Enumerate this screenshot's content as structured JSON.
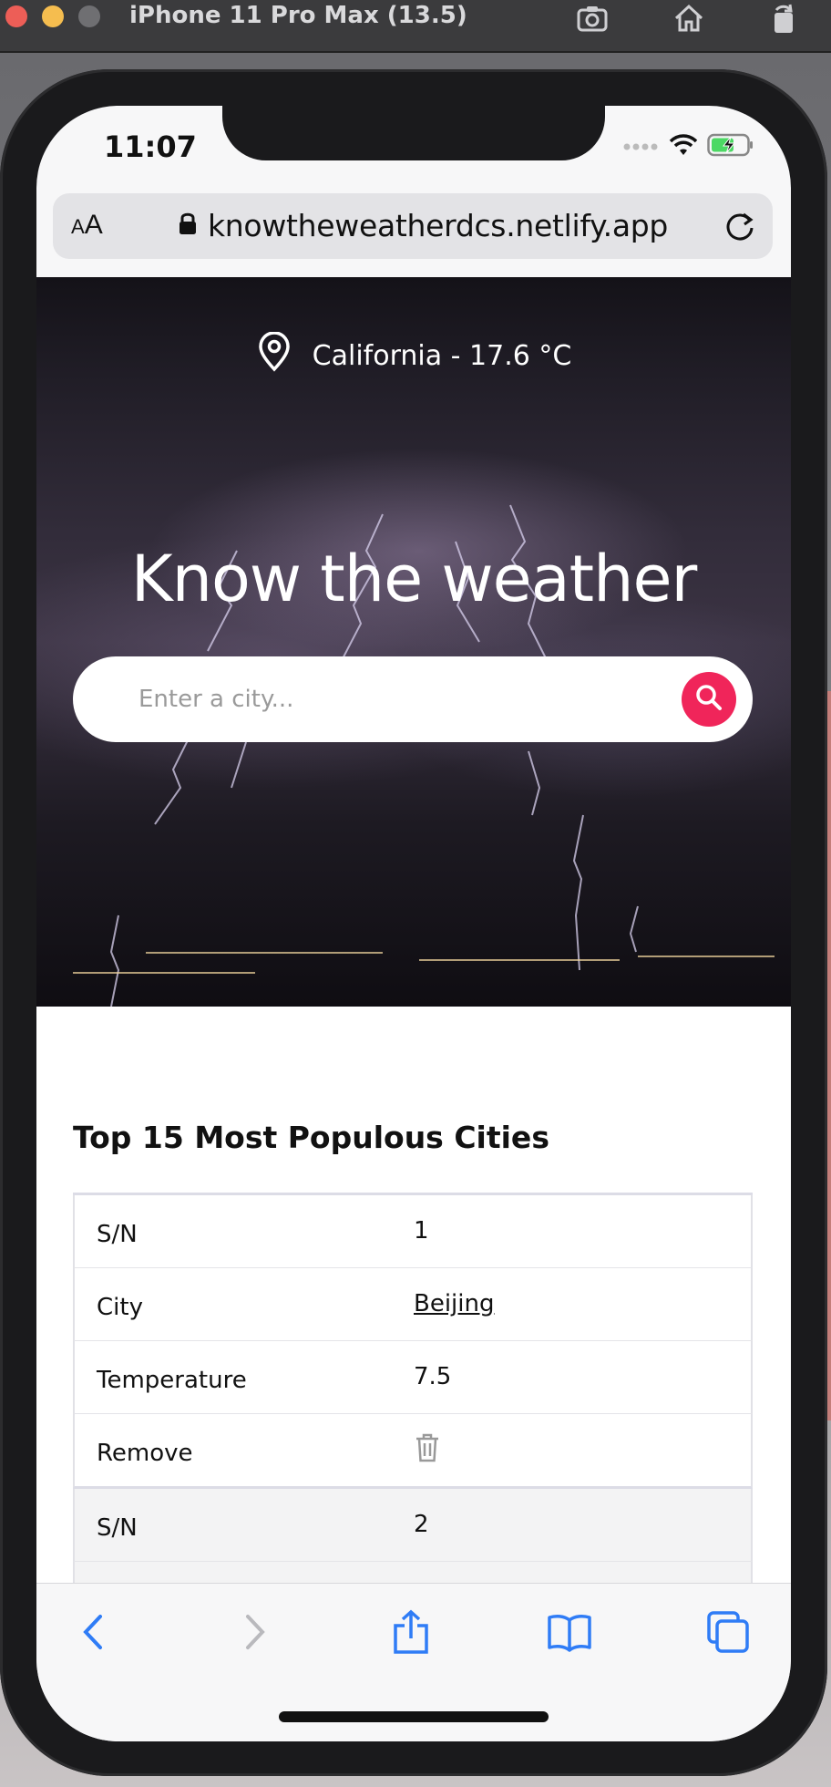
{
  "simulator": {
    "title": "iPhone 11 Pro Max (13.5)",
    "icons": [
      "screenshot-icon",
      "home-icon",
      "rotate-icon"
    ]
  },
  "status_bar": {
    "time": "11:07",
    "icons": [
      "signal-dots-icon",
      "wifi-icon",
      "battery-charging-icon"
    ]
  },
  "browser": {
    "text_size_label_small": "A",
    "text_size_label_large": "A",
    "url": "knowtheweatherdcs.netlify.app"
  },
  "hero": {
    "location": "California - 17.6 °C",
    "title": "Know the weather",
    "search_placeholder": "Enter a city..."
  },
  "section": {
    "title": "Top 15 Most Populous Cities"
  },
  "table": {
    "rows": [
      {
        "key": "S/N",
        "value": "1"
      },
      {
        "key": "City",
        "value": "Beijing"
      },
      {
        "key": "Temperature",
        "value": "7.5"
      },
      {
        "key": "Remove",
        "value": ""
      },
      {
        "key": "S/N",
        "value": "2"
      }
    ]
  },
  "colors": {
    "accent": "#f0255a",
    "safari_blue": "#2f7cf6"
  }
}
